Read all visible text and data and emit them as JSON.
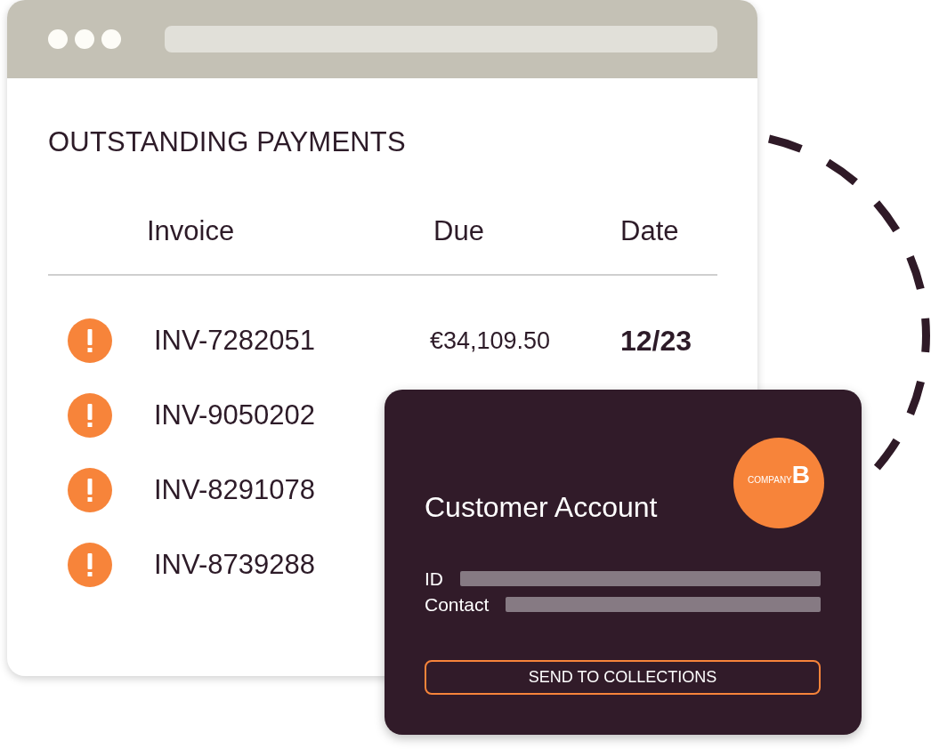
{
  "payments": {
    "title": "OUTSTANDING PAYMENTS",
    "columns": [
      "Invoice",
      "Due",
      "Date"
    ],
    "rows": [
      {
        "invoice": "INV-7282051",
        "due": "€34,109.50",
        "date": "12/23"
      },
      {
        "invoice": "INV-9050202"
      },
      {
        "invoice": "INV-8291078"
      },
      {
        "invoice": "INV-8739288"
      }
    ]
  },
  "customer_card": {
    "title": "Customer Account",
    "logo": {
      "word": "COMPANY",
      "letter": "B"
    },
    "fields": [
      {
        "label": "ID"
      },
      {
        "label": "Contact"
      }
    ],
    "button": "SEND TO COLLECTIONS"
  }
}
